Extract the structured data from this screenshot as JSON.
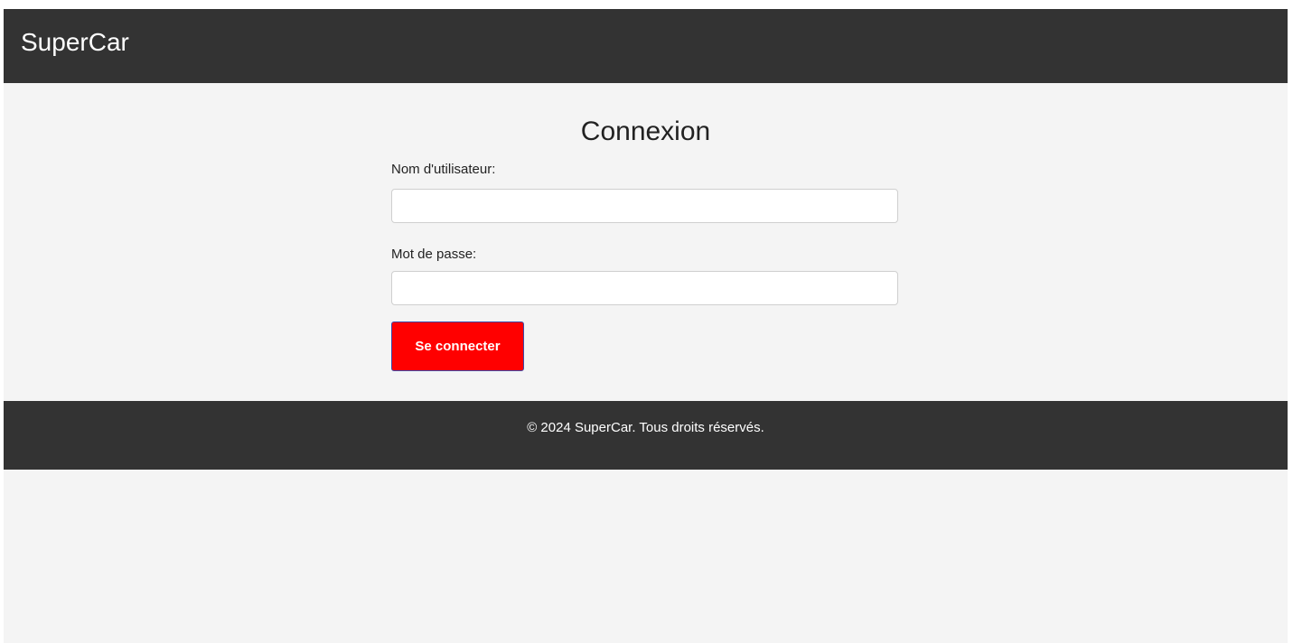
{
  "header": {
    "brand": "SuperCar"
  },
  "login": {
    "title": "Connexion",
    "username_label": "Nom d'utilisateur:",
    "username_value": "",
    "password_label": "Mot de passe:",
    "password_value": "",
    "submit_label": "Se connecter"
  },
  "footer": {
    "text": "© 2024 SuperCar. Tous droits réservés."
  },
  "colors": {
    "header_bg": "#333333",
    "page_bg": "#f4f4f4",
    "button_bg": "#ff0000",
    "button_border": "#3d4aa8",
    "footer_bg": "#333333"
  }
}
